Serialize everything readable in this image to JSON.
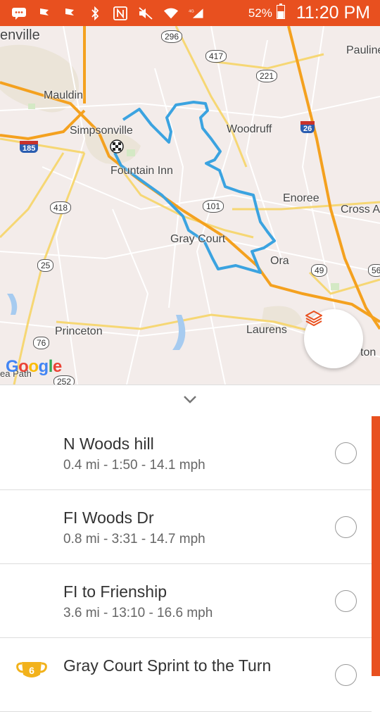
{
  "status_bar": {
    "battery": "52%",
    "time": "11:20 PM",
    "network": "4G"
  },
  "map": {
    "places": [
      "enville",
      "Pauline",
      "Mauldin",
      "Simpsonville",
      "Woodruff",
      "Fountain Inn",
      "Enoree",
      "Cross A",
      "Gray Court",
      "Ora",
      "Princeton",
      "Laurens",
      "ton",
      "ea Path"
    ],
    "routes": [
      "296",
      "417",
      "221",
      "26",
      "185",
      "418",
      "101",
      "25",
      "49",
      "56",
      "76",
      "252"
    ],
    "logo": "Google",
    "colors": {
      "route_track": "#3ba3e0",
      "highway": "#f4a11f",
      "accent": "#e8501f"
    }
  },
  "segments": [
    {
      "name": "N Woods hill",
      "stats": "0.4 mi - 1:50 - 14.1 mph"
    },
    {
      "name": "FI Woods Dr",
      "stats": "0.8 mi - 3:31 - 14.7 mph"
    },
    {
      "name": "FI to Frienship",
      "stats": "3.6 mi - 13:10 - 16.6 mph"
    },
    {
      "name": "Gray Court Sprint to the Turn",
      "stats": "",
      "trophy_rank": "6"
    }
  ]
}
